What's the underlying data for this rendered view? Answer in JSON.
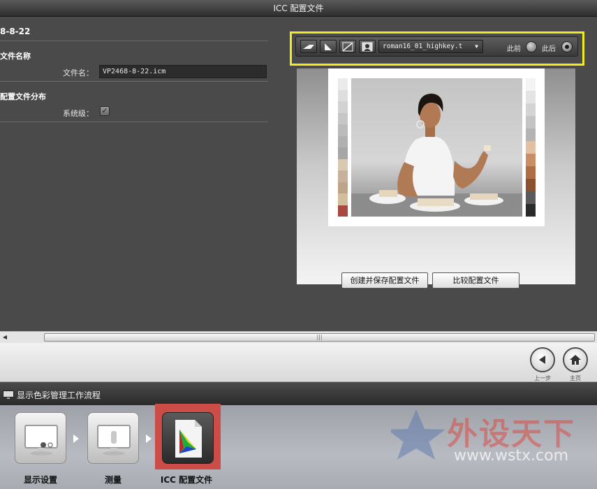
{
  "window": {
    "title": "ICC 配置文件"
  },
  "left_panel": {
    "profile_name": "8-8-22",
    "section_filename": "文件名称",
    "filename_label": "文件名：",
    "filename_value": "VP2468-8-22.icm",
    "section_distribution": "配置文件分布",
    "system_label": "系统级：",
    "system_checked": true,
    "check_glyph": "✓"
  },
  "preview": {
    "selected_image": "roman16_01_highkey.t",
    "before_label": "此前",
    "after_label": "此后",
    "selected_radio": "after",
    "tools": [
      "eyedropper-icon",
      "triangle-icon",
      "curve-icon",
      "portrait-icon"
    ],
    "create_button": "创建并保存配置文件",
    "compare_button": "比较配置文件",
    "left_strip_colors": [
      "#ebebeb",
      "#dedede",
      "#d2d2d2",
      "#c6c6c6",
      "#bbbbbb",
      "#b0b0b0",
      "#a6a6a6",
      "#d9c9b3",
      "#c8b19a",
      "#bfa488",
      "#d1bf9c",
      "#a94a40"
    ],
    "right_strip_colors": [
      "#f4f4f4",
      "#e4e4e4",
      "#d4d4d4",
      "#c4c4c4",
      "#b4b4b4",
      "#e2c0a4",
      "#c98e66",
      "#b06e44",
      "#8c5230",
      "#5a5a5a",
      "#2a2a2a"
    ]
  },
  "navigation": {
    "back_label": "上一步",
    "home_label": "主页"
  },
  "workflow": {
    "title": "显示色彩管理工作流程",
    "steps": [
      {
        "label": "显示设置",
        "icon": "display-settings-icon",
        "active": false
      },
      {
        "label": "测量",
        "icon": "measure-icon",
        "active": false
      },
      {
        "label": "ICC 配置文件",
        "icon": "icc-profile-icon",
        "active": true
      }
    ]
  },
  "watermark": {
    "text": "外设天下",
    "url": "www.wstx.com"
  },
  "colors": {
    "highlight": "#f2ec1e",
    "active_step": "#cc4c48"
  }
}
